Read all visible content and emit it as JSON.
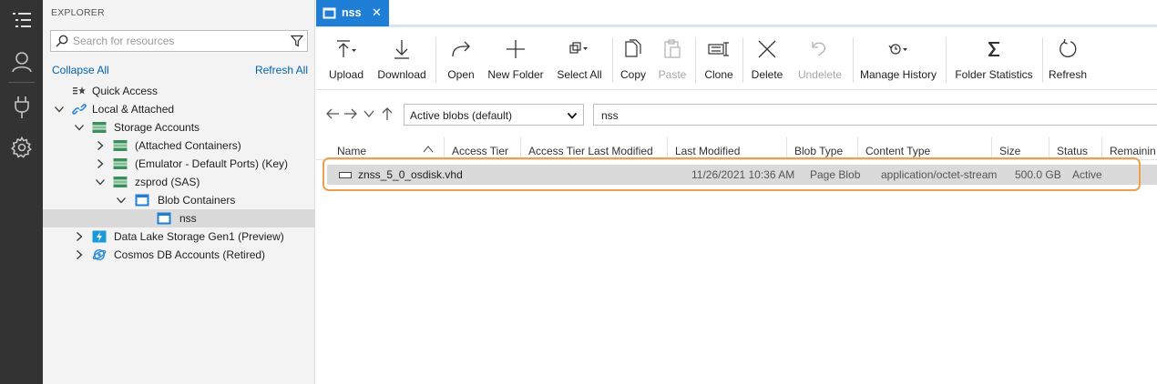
{
  "explorer": {
    "title": "EXPLORER",
    "search_placeholder": "Search for resources",
    "collapse_all": "Collapse All",
    "refresh_all": "Refresh All",
    "tree": {
      "quick_access": "Quick Access",
      "local_attached": "Local & Attached",
      "storage_accounts": "Storage Accounts",
      "attached_containers": "(Attached Containers)",
      "emulator": "(Emulator - Default Ports) (Key)",
      "zsprod": "zsprod (SAS)",
      "blob_containers": "Blob Containers",
      "nss": "nss",
      "data_lake": "Data Lake Storage Gen1 (Preview)",
      "cosmos": "Cosmos DB Accounts (Retired)"
    }
  },
  "tab": {
    "label": "nss",
    "close": "✕",
    "accent": "#1f7fd6"
  },
  "toolbar": {
    "upload": "Upload",
    "download": "Download",
    "open": "Open",
    "new_folder": "New Folder",
    "select_all": "Select All",
    "copy": "Copy",
    "paste": "Paste",
    "clone": "Clone",
    "delete": "Delete",
    "undelete": "Undelete",
    "manage_history": "Manage History",
    "folder_statistics": "Folder Statistics",
    "refresh": "Refresh"
  },
  "nav": {
    "view_select": "Active blobs (default)",
    "path": "nss"
  },
  "grid": {
    "columns": {
      "name": "Name",
      "access_tier": "Access Tier",
      "access_tier_last_modified": "Access Tier Last Modified",
      "last_modified": "Last Modified",
      "blob_type": "Blob Type",
      "content_type": "Content Type",
      "size": "Size",
      "status": "Status",
      "remaining": "Remainin"
    },
    "rows": [
      {
        "name": "znss_5_0_osdisk.vhd",
        "last_modified": "11/26/2021 10:36 AM",
        "blob_type": "Page Blob",
        "content_type": "application/octet-stream",
        "size": "500.0 GB",
        "status": "Active"
      }
    ],
    "highlight_color": "#f0a04b"
  }
}
